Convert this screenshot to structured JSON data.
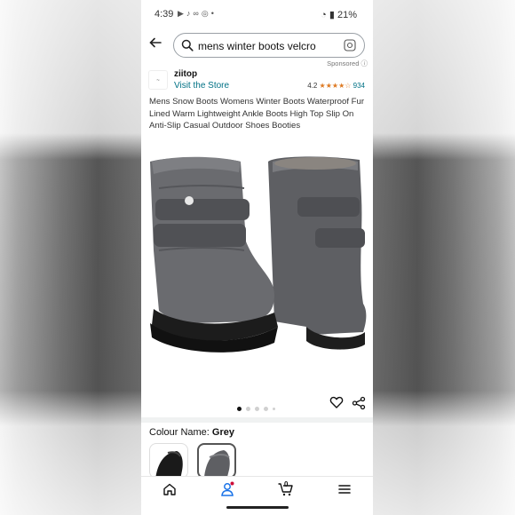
{
  "status_bar": {
    "time": "4:39",
    "icons": [
      "youtube-icon",
      "tiktok-icon",
      "link-icon",
      "instagram-icon",
      "dot-icon"
    ],
    "battery": "21%"
  },
  "search": {
    "query": "mens winter boots velcro"
  },
  "sponsored_label": "Sponsored",
  "store": {
    "brand": "ziitop",
    "visit_label": "Visit the Store",
    "rating_value": "4.2",
    "stars": "★★★★☆",
    "rating_count": "934"
  },
  "product": {
    "title": "Mens Snow Boots Womens Winter Boots Waterproof Fur Lined Warm Lightweight Ankle Boots High Top Slip On Anti-Slip Casual Outdoor Shoes Booties",
    "image_alt": "grey snow boots with velcro straps",
    "carousel_total": 5,
    "carousel_active": 1
  },
  "colour": {
    "label": "Colour Name: ",
    "value": "Grey",
    "swatches": [
      "black",
      "grey"
    ]
  },
  "bottom_nav": [
    "home-icon",
    "account-icon",
    "cart-icon",
    "menu-icon"
  ],
  "cart_count": "0",
  "colors": {
    "link": "#007185",
    "star": "#de7921",
    "accent_badge": "#cc0c39"
  }
}
